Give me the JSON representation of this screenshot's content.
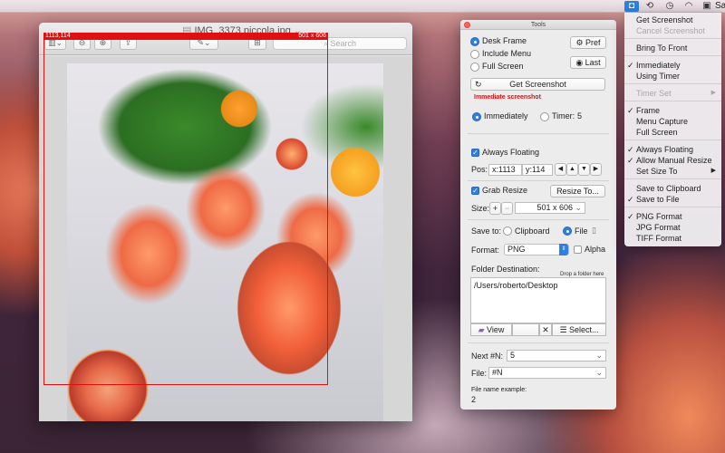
{
  "menubar": {
    "right_text": "Sa",
    "icons": [
      "camera-icon",
      "time-machine-icon",
      "clock-icon",
      "wifi-icon",
      "display-icon"
    ]
  },
  "preview": {
    "title": "IMG_3373 piccola.jpg",
    "search_placeholder": "Search",
    "selection_origin": "1113,114",
    "selection_size": "501 x 606"
  },
  "tools": {
    "title": "Tools",
    "capture_modes": [
      "Desk Frame",
      "Include Menu",
      "Full Screen"
    ],
    "pref_label": "Pref",
    "last_label": "Last",
    "get_screenshot_label": "Get Screenshot",
    "status_text": "Immediate screenshot",
    "immediately_label": "Immediately",
    "timer_label": "Timer:",
    "timer_value": "5",
    "always_floating_label": "Always Floating",
    "pos_label": "Pos:",
    "pos_x": "x:1113",
    "pos_y": "y:114",
    "grab_resize_label": "Grab Resize",
    "resize_to_label": "Resize To...",
    "size_label": "Size:",
    "size_value": "501 x 606",
    "save_to_label": "Save to:",
    "clipboard_label": "Clipboard",
    "file_label": "File",
    "format_label": "Format:",
    "format_value": "PNG",
    "alpha_label": "Alpha",
    "folder_destination_label": "Folder Destination:",
    "drop_hint": "Drop a folder here",
    "folder_path": "/Users/roberto/Desktop",
    "view_label": "View",
    "select_label": "Select...",
    "next_label": "Next #N:",
    "next_value": "5",
    "file_name_label": "File:",
    "file_name_value": "#N",
    "file_example_label": "File name example:",
    "file_example_value": "2"
  },
  "menu": {
    "items": [
      {
        "label": "Get Screenshot",
        "checked": false,
        "disabled": false
      },
      {
        "label": "Cancel Screenshot",
        "checked": false,
        "disabled": true
      },
      {
        "label": "Bring To Front",
        "checked": false,
        "disabled": false
      },
      {
        "label": "Immediately",
        "checked": true,
        "disabled": false
      },
      {
        "label": "Using Timer",
        "checked": false,
        "disabled": false
      },
      {
        "label": "Timer Set",
        "checked": false,
        "disabled": true
      },
      {
        "label": "Frame",
        "checked": true,
        "disabled": false
      },
      {
        "label": "Menu Capture",
        "checked": false,
        "disabled": false
      },
      {
        "label": "Full Screen",
        "checked": false,
        "disabled": false
      },
      {
        "label": "Always Floating",
        "checked": true,
        "disabled": false
      },
      {
        "label": "Allow Manual Resize",
        "checked": true,
        "disabled": false
      },
      {
        "label": "Set Size To",
        "checked": false,
        "disabled": false
      },
      {
        "label": "Save to Clipboard",
        "checked": false,
        "disabled": false
      },
      {
        "label": "Save to File",
        "checked": true,
        "disabled": false
      },
      {
        "label": "PNG Format",
        "checked": true,
        "disabled": false
      },
      {
        "label": "JPG Format",
        "checked": false,
        "disabled": false
      },
      {
        "label": "TIFF Format",
        "checked": false,
        "disabled": false
      }
    ]
  },
  "colors": {
    "accent": "#2f7fde",
    "selection_red": "#e01010"
  }
}
